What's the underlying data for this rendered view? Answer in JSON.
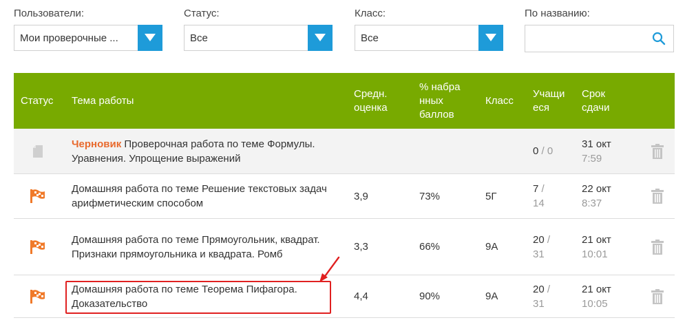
{
  "filters": {
    "users": {
      "label": "Пользователи:",
      "value": "Мои проверочные ..."
    },
    "status": {
      "label": "Статус:",
      "value": "Все"
    },
    "class": {
      "label": "Класс:",
      "value": "Все"
    },
    "search": {
      "label": "По названию:",
      "value": ""
    }
  },
  "table": {
    "headers": {
      "status": "Статус",
      "theme": "Тема работы",
      "avg_l1": "Средн.",
      "avg_l2": "оценка",
      "pct_l1": "% набра",
      "pct_l2": "нных",
      "pct_l3": "баллов",
      "class": "Класс",
      "students_l1": "Учащи",
      "students_l2": "еся",
      "due_l1": "Срок",
      "due_l2": "сдачи"
    },
    "rows": [
      {
        "status_icon": "draft-document-icon",
        "draft_label": "Черновик",
        "theme": "Проверочная работа по теме Формулы. Уравнения. Упрощение выражений",
        "avg": "",
        "percent": "",
        "class": "",
        "students_done": "0",
        "students_sep": " / ",
        "students_total": "0",
        "due_date": "31 окт",
        "due_time": "7:59"
      },
      {
        "status_icon": "checkered-flag-icon",
        "draft_label": "",
        "theme": "Домашняя работа по теме Решение текстовых задач арифметическим способом",
        "avg": "3,9",
        "percent": "73%",
        "class": "5Г",
        "students_done": "7",
        "students_sep": " /",
        "students_total": "14",
        "due_date": "22 окт",
        "due_time": "8:37"
      },
      {
        "status_icon": "checkered-flag-icon",
        "draft_label": "",
        "theme": "Домашняя работа по теме Прямоугольник, квадрат. Признаки прямоугольника и квадрата. Ромб",
        "avg": "3,3",
        "percent": "66%",
        "class": "9А",
        "students_done": "20",
        "students_sep": " /",
        "students_total": "31",
        "due_date": "21 окт",
        "due_time": "10:01"
      },
      {
        "status_icon": "checkered-flag-icon",
        "draft_label": "",
        "theme": "Домашняя работа по теме Теорема Пифагора. Доказательство",
        "avg": "4,4",
        "percent": "90%",
        "class": "9А",
        "students_done": "20",
        "students_sep": " /",
        "students_total": "31",
        "due_date": "21 окт",
        "due_time": "10:05"
      }
    ]
  },
  "colors": {
    "header_green": "#78aa00",
    "accent_blue": "#1e9bd9",
    "draft_orange": "#e86a2e",
    "flag_orange": "#f07a2a",
    "highlight_red": "#e02020"
  }
}
